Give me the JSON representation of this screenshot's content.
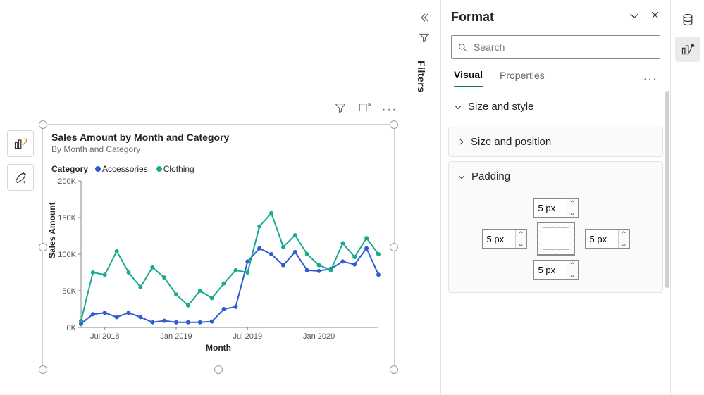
{
  "chart_data": {
    "type": "line",
    "title": "Sales Amount by Month and Category",
    "subtitle": "By Month and Category",
    "legend_header": "Category",
    "xlabel": "Month",
    "ylabel": "Sales Amount",
    "ylim": [
      0,
      200000
    ],
    "yticks": [
      0,
      50000,
      100000,
      150000,
      200000
    ],
    "xticks": [
      "Jul 2018",
      "Jan 2019",
      "Jul 2019",
      "Jan 2020"
    ],
    "categories": [
      "2018-05",
      "2018-06",
      "2018-07",
      "2018-08",
      "2018-09",
      "2018-10",
      "2018-11",
      "2018-12",
      "2019-01",
      "2019-02",
      "2019-03",
      "2019-04",
      "2019-05",
      "2019-06",
      "2019-07",
      "2019-08",
      "2019-09",
      "2019-10",
      "2019-11",
      "2019-12",
      "2020-01",
      "2020-02",
      "2020-03",
      "2020-04",
      "2020-05",
      "2020-06"
    ],
    "series": [
      {
        "name": "Accessories",
        "color": "#2f5bd2",
        "values": [
          5000,
          18000,
          20000,
          14000,
          20000,
          14000,
          7000,
          9000,
          7000,
          7000,
          7000,
          8000,
          25000,
          28000,
          90000,
          108000,
          100000,
          85000,
          103000,
          78000,
          77000,
          80000,
          90000,
          86000,
          108000,
          72000
        ]
      },
      {
        "name": "Clothing",
        "color": "#1aa991",
        "values": [
          9000,
          75000,
          72000,
          104000,
          75000,
          55000,
          82000,
          68000,
          45000,
          30000,
          50000,
          40000,
          60000,
          78000,
          75000,
          138000,
          156000,
          110000,
          126000,
          100000,
          85000,
          78000,
          115000,
          96000,
          122000,
          100000
        ]
      }
    ]
  },
  "chart_yticks_display": [
    "0K",
    "50K",
    "100K",
    "150K",
    "200K"
  ],
  "filters_label": "Filters",
  "format": {
    "title": "Format",
    "search_placeholder": "Search",
    "tabs": {
      "visual": "Visual",
      "properties": "Properties"
    },
    "sections": {
      "size_style": "Size and style",
      "size_position": "Size and position",
      "padding": "Padding"
    },
    "padding": {
      "top": "5 px",
      "left": "5 px",
      "right": "5 px",
      "bottom": "5 px"
    }
  }
}
